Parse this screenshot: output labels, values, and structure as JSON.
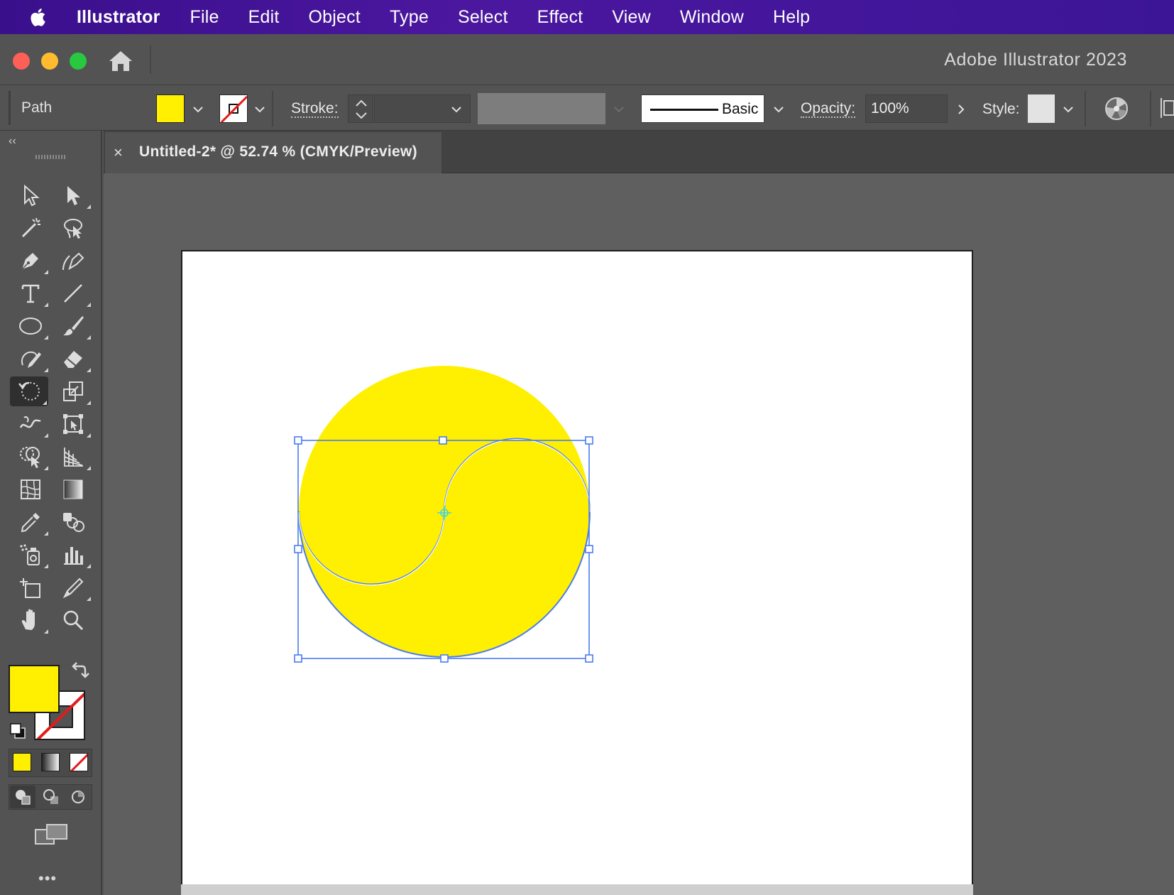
{
  "menubar": {
    "apple_icon": "apple-logo",
    "app_name": "Illustrator",
    "items": [
      "File",
      "Edit",
      "Object",
      "Type",
      "Select",
      "Effect",
      "View",
      "Window",
      "Help"
    ]
  },
  "appbar": {
    "home_icon": "home-icon",
    "title": "Adobe Illustrator 2023"
  },
  "controlbar": {
    "selection_type": "Path",
    "fill_color": "#ffef00",
    "stroke_color": "none",
    "stroke_label": "Stroke:",
    "brush_label": "Basic",
    "opacity_label": "Opacity:",
    "opacity_value": "100%",
    "style_label": "Style:",
    "recolor_icon": "recolor-artwork-icon"
  },
  "document": {
    "tab_title": "Untitled-2* @ 52.74 % (CMYK/Preview)",
    "close_glyph": "×"
  },
  "tools": {
    "collapse_glyph": "‹‹",
    "more_glyph": "•••",
    "active_tool": "rotate-tool",
    "fill_color": "#ffef00",
    "stroke_color": "none"
  },
  "artwork": {
    "fill_color": "#ffef00",
    "selection_color": "#4a7cf0",
    "center_point_color": "#3fd4e8"
  }
}
